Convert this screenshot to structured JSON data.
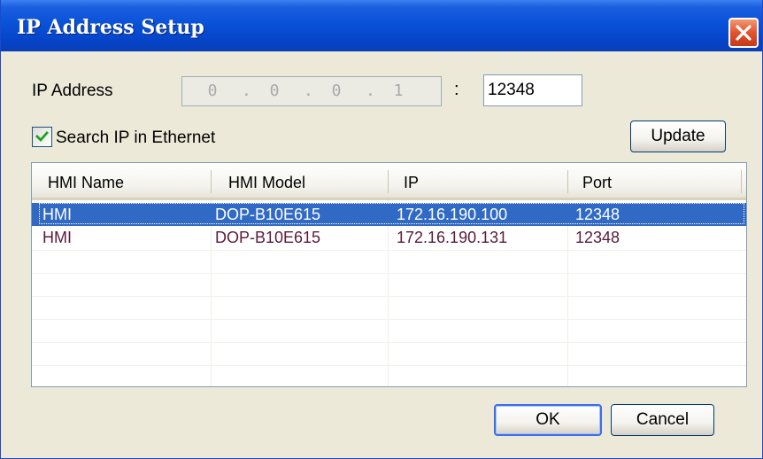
{
  "window": {
    "title": "IP Address Setup",
    "close_icon": "close-icon"
  },
  "ip": {
    "label": "IP Address",
    "octets": [
      "0",
      "0",
      "0",
      "1"
    ],
    "separator": ".",
    "colon": ":",
    "port": "12348"
  },
  "search": {
    "label": "Search IP in Ethernet",
    "checked": true
  },
  "buttons": {
    "update": "Update",
    "ok": "OK",
    "cancel": "Cancel"
  },
  "table": {
    "columns": [
      "HMI Name",
      "HMI Model",
      "IP",
      "Port"
    ],
    "rows": [
      {
        "name": "HMI",
        "model": "DOP-B10E615",
        "ip": "172.16.190.100",
        "port": "12348",
        "selected": true
      },
      {
        "name": "HMI",
        "model": "DOP-B10E615",
        "ip": "172.16.190.131",
        "port": "12348",
        "selected": false
      }
    ]
  },
  "colors": {
    "titlebar": "#0a52d8",
    "selection": "#316ac5",
    "row_text": "#5a1a3a",
    "close_button": "#e2532f"
  }
}
